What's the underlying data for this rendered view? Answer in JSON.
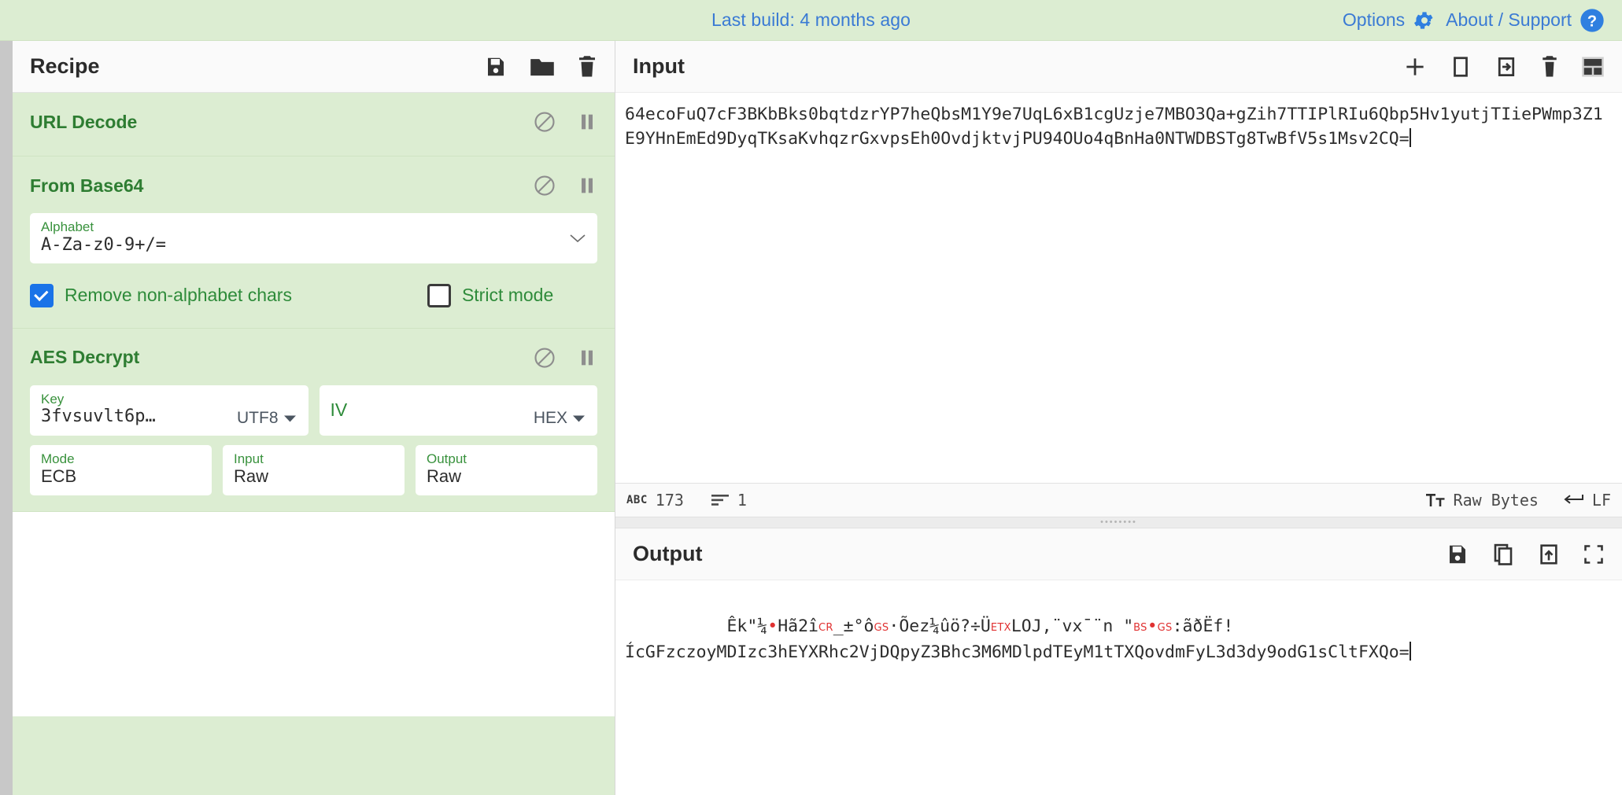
{
  "banner": {
    "build_text": "Last build: 4 months ago",
    "options_label": "Options",
    "about_label": "About / Support",
    "link_color": "#3a7ad4",
    "background": "#dcedd2"
  },
  "recipe": {
    "title": "Recipe",
    "tools": [
      {
        "name": "save-recipe-icon",
        "label": "Save recipe"
      },
      {
        "name": "load-recipe-icon",
        "label": "Load recipe"
      },
      {
        "name": "clear-recipe-icon",
        "label": "Clear recipe"
      }
    ],
    "operations": [
      {
        "title": "URL Decode",
        "disable_label": "Disable operation",
        "breakpoint_label": "Set breakpoint",
        "args": []
      },
      {
        "title": "From Base64",
        "disable_label": "Disable operation",
        "breakpoint_label": "Set breakpoint",
        "alphabet_label": "Alphabet",
        "alphabet_value": "A-Za-z0-9+/=",
        "checkbox_remove_label": "Remove non-alphabet chars",
        "checkbox_remove_checked": true,
        "checkbox_strict_label": "Strict mode",
        "checkbox_strict_checked": false
      },
      {
        "title": "AES Decrypt",
        "disable_label": "Disable operation",
        "breakpoint_label": "Set breakpoint",
        "key_label": "Key",
        "key_value": "3fvsuvlt6p…",
        "key_encoding": "UTF8",
        "iv_label": "IV",
        "iv_value": "",
        "iv_encoding": "HEX",
        "mode_label": "Mode",
        "mode_value": "ECB",
        "input_label": "Input",
        "input_value": "Raw",
        "output_label": "Output",
        "output_value": "Raw"
      }
    ]
  },
  "input": {
    "title": "Input",
    "tools": [
      {
        "name": "add-input-tab-icon",
        "label": "Add a new input"
      },
      {
        "name": "open-folder-as-input-icon",
        "label": "Open folder as input"
      },
      {
        "name": "open-file-as-input-icon",
        "label": "Open file as input"
      },
      {
        "name": "clear-input-icon",
        "label": "Clear input and output"
      },
      {
        "name": "reset-pane-layout-icon",
        "label": "Reset pane layout"
      }
    ],
    "text_line1": "64ecoFuQ7cF3BKbBks0bqtdzrYP7heQbsM1Y9e7UqL6xB1cgUzje7MBO3Qa+gZih7TTIPlRIu6Qbp5Hv1yutjTIiePWmp3Z1",
    "text_line2": "E9YHnEmEd9DyqTKsaKvhqzrGxvpsEh0OvdjktvjPU94OUo4qBnHa0NTWDBSTg8TwBfV5s1Msv2CQ=",
    "status": {
      "length_icon": "ABC",
      "length_value": "173",
      "lines_icon": "lines-icon",
      "lines_value": "1",
      "charenc_icon": "font-icon",
      "charenc_value": "Raw Bytes",
      "eol_icon": "return-icon",
      "eol_value": "LF"
    }
  },
  "output": {
    "title": "Output",
    "tools": [
      {
        "name": "save-output-icon",
        "label": "Save output to file"
      },
      {
        "name": "copy-output-icon",
        "label": "Copy raw output to the clipboard"
      },
      {
        "name": "replace-input-with-output-icon",
        "label": "Replace input with output"
      },
      {
        "name": "maximise-output-icon",
        "label": "Maximise output pane"
      }
    ],
    "line1_segments": [
      {
        "type": "text",
        "value": "Êk\"¼"
      },
      {
        "type": "dot",
        "value": "•"
      },
      {
        "type": "text",
        "value": "Hã2î"
      },
      {
        "type": "ctrl",
        "value": "CR"
      },
      {
        "type": "text",
        "value": "_±°ô"
      },
      {
        "type": "ctrl",
        "value": "GS"
      },
      {
        "type": "text",
        "value": "·Õez¼ûö?÷Ü"
      },
      {
        "type": "ctrl",
        "value": "ETX"
      },
      {
        "type": "text",
        "value": "LOJ,¨vx¯¨n \""
      },
      {
        "type": "ctrl",
        "value": "BS"
      },
      {
        "type": "dot",
        "value": "•"
      },
      {
        "type": "ctrl",
        "value": "GS"
      },
      {
        "type": "text",
        "value": ":ãðËf!"
      }
    ],
    "line2": "ÍcGFzczoyMDIzc3hEYXRhc2VjDQpyZ3Bhc3M6MDlpdTEyM1tTXQovdmFyL3d3dy9odG1sCltFXQo="
  }
}
